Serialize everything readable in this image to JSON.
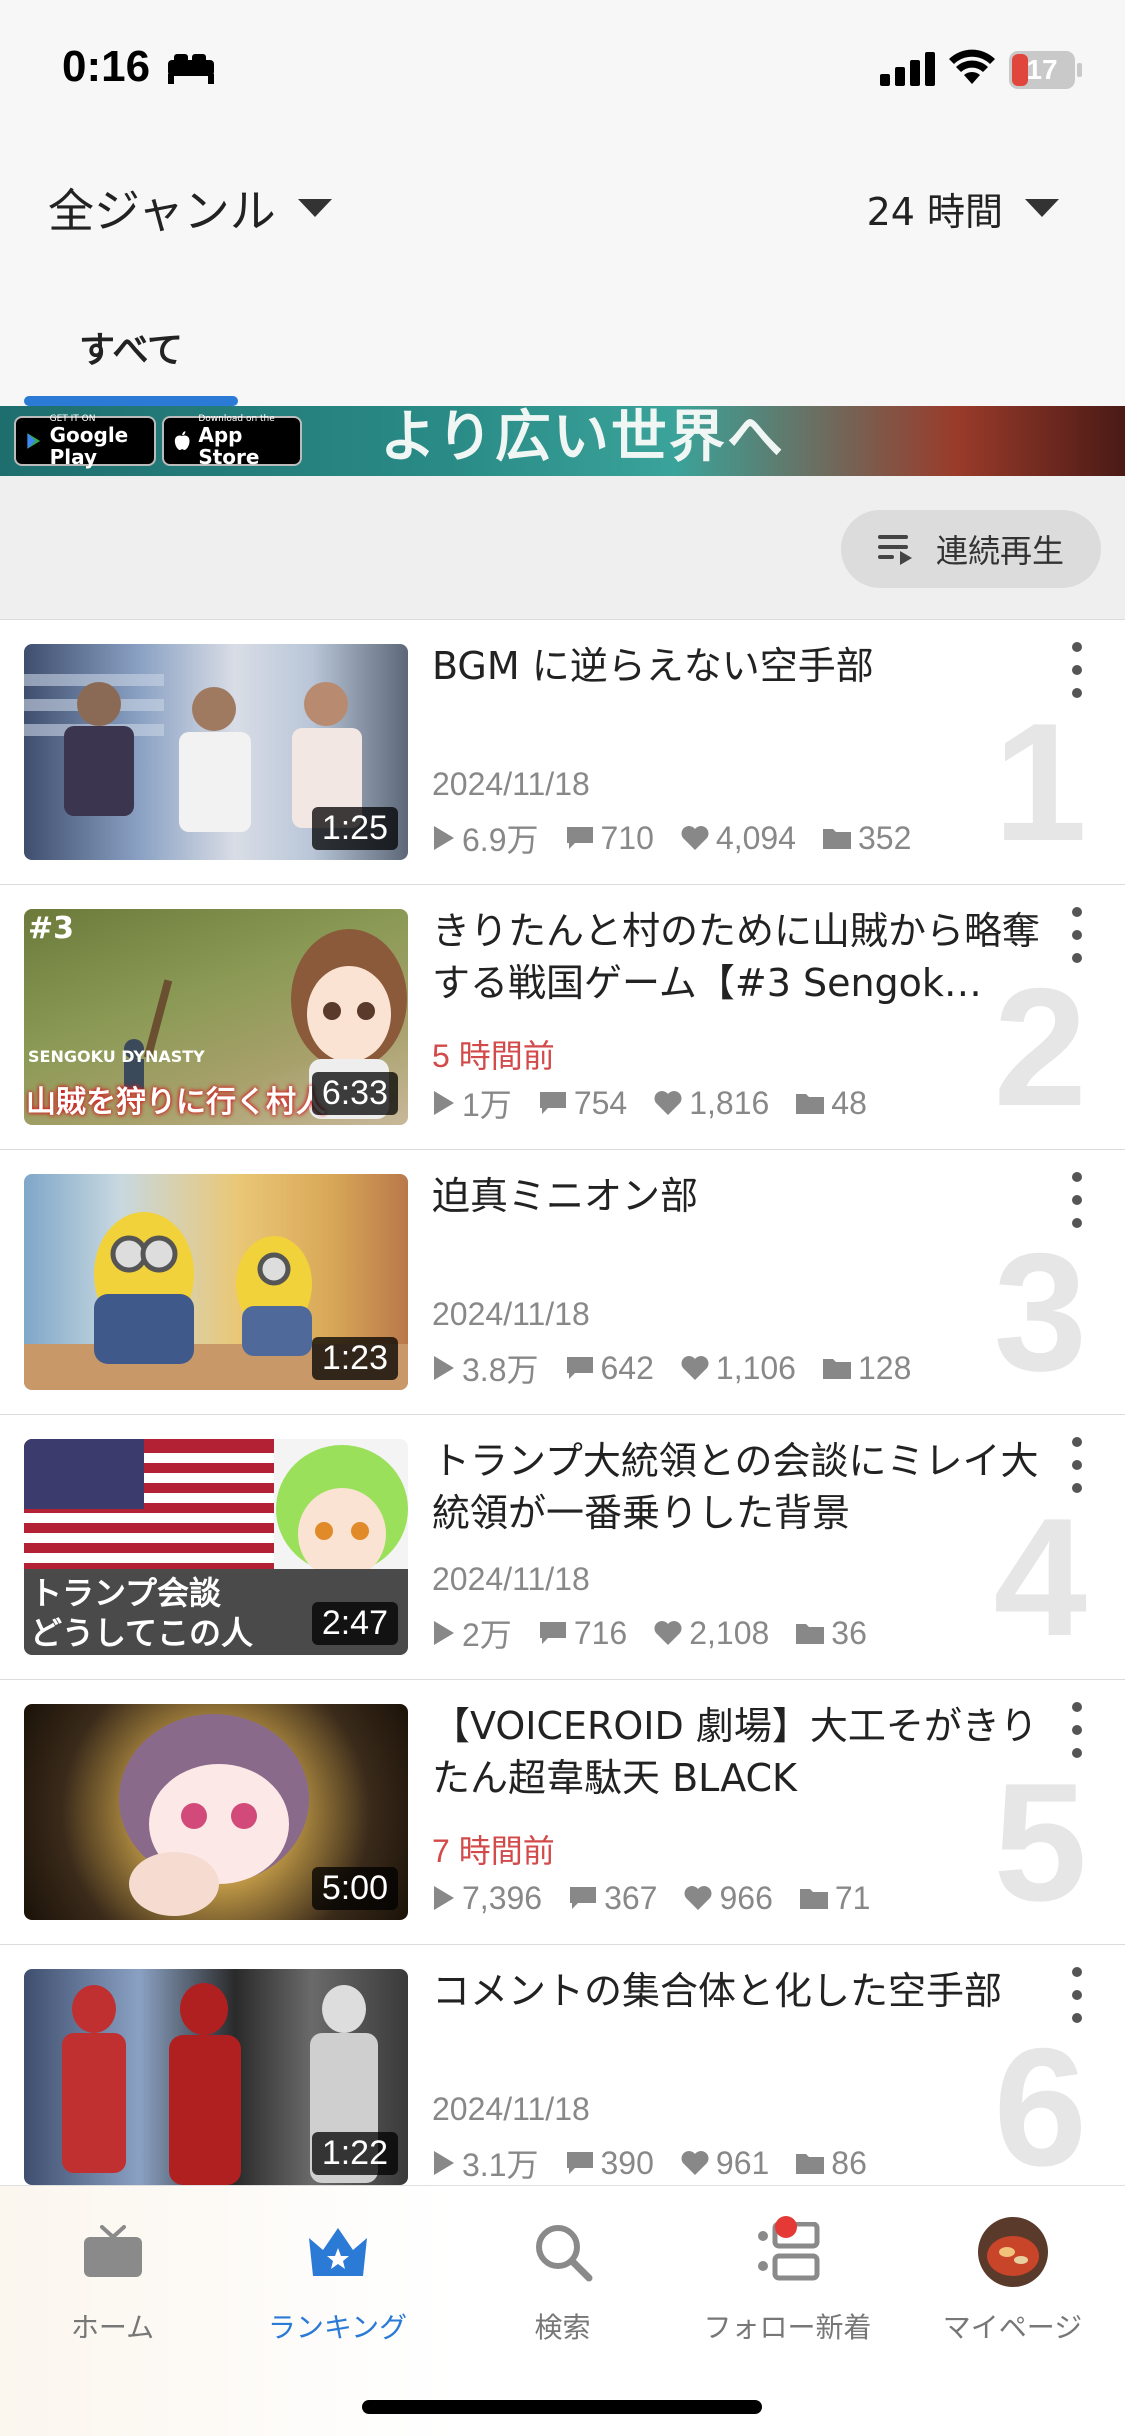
{
  "status_bar": {
    "time": "0:16",
    "battery": "17"
  },
  "header": {
    "genre": "全ジャンル",
    "period": "24 時間",
    "tab_all": "すべて"
  },
  "banner": {
    "google_play_small": "GET IT ON",
    "google_play_big": "Google Play",
    "app_store_small": "Download on the",
    "app_store_big": "App Store",
    "tagline": "より広い世界へ"
  },
  "continuous_play": {
    "label": "連続再生"
  },
  "items": [
    {
      "rank": "1",
      "title": "BGM に逆らえない空手部",
      "duration": "1:25",
      "date": "2024/11/18",
      "recent": false,
      "views": "6.9万",
      "comments": "710",
      "likes": "4,094",
      "mylists": "352"
    },
    {
      "rank": "2",
      "title": "きりたんと村のために山賊から略奪する戦国ゲーム【#3 Sengok…",
      "duration": "6:33",
      "date": "5 時間前",
      "recent": true,
      "views": "1万",
      "comments": "754",
      "likes": "1,816",
      "mylists": "48"
    },
    {
      "rank": "3",
      "title": "迫真ミニオン部",
      "duration": "1:23",
      "date": "2024/11/18",
      "recent": false,
      "views": "3.8万",
      "comments": "642",
      "likes": "1,106",
      "mylists": "128"
    },
    {
      "rank": "4",
      "title": "トランプ大統領との会談にミレイ大統領が一番乗りした背景",
      "duration": "2:47",
      "date": "2024/11/18",
      "recent": false,
      "views": "2万",
      "comments": "716",
      "likes": "2,108",
      "mylists": "36"
    },
    {
      "rank": "5",
      "title": "【VOICEROID 劇場】大工そがきりたん超韋駄天 BLACK",
      "duration": "5:00",
      "date": "7 時間前",
      "recent": true,
      "views": "7,396",
      "comments": "367",
      "likes": "966",
      "mylists": "71"
    },
    {
      "rank": "6",
      "title": "コメントの集合体と化した空手部",
      "duration": "1:22",
      "date": "2024/11/18",
      "recent": false,
      "views": "3.1万",
      "comments": "390",
      "likes": "961",
      "mylists": "86"
    }
  ],
  "thumb_text": {
    "t2_tag": "#3",
    "t2_logo": "SENGOKU DYNASTY",
    "t2_caption": "山賊を狩りに行く村人",
    "t4_caption1": "トランプ会談",
    "t4_caption2": "どうしてこの人"
  },
  "nav": {
    "home": "ホーム",
    "ranking": "ランキング",
    "search": "検索",
    "follow": "フォロー新着",
    "mypage": "マイページ"
  },
  "colors": {
    "accent": "#2b7bd6",
    "recent": "#d24a4a",
    "notify": "#e53935"
  },
  "icons": {
    "status": [
      "bed-icon",
      "signal-icon",
      "wifi-icon",
      "battery-icon"
    ],
    "stats": [
      "play-icon",
      "comment-icon",
      "heart-icon",
      "folder-icon"
    ],
    "nav": [
      "tv-icon",
      "crown-icon",
      "search-icon",
      "follow-list-icon",
      "avatar"
    ]
  }
}
